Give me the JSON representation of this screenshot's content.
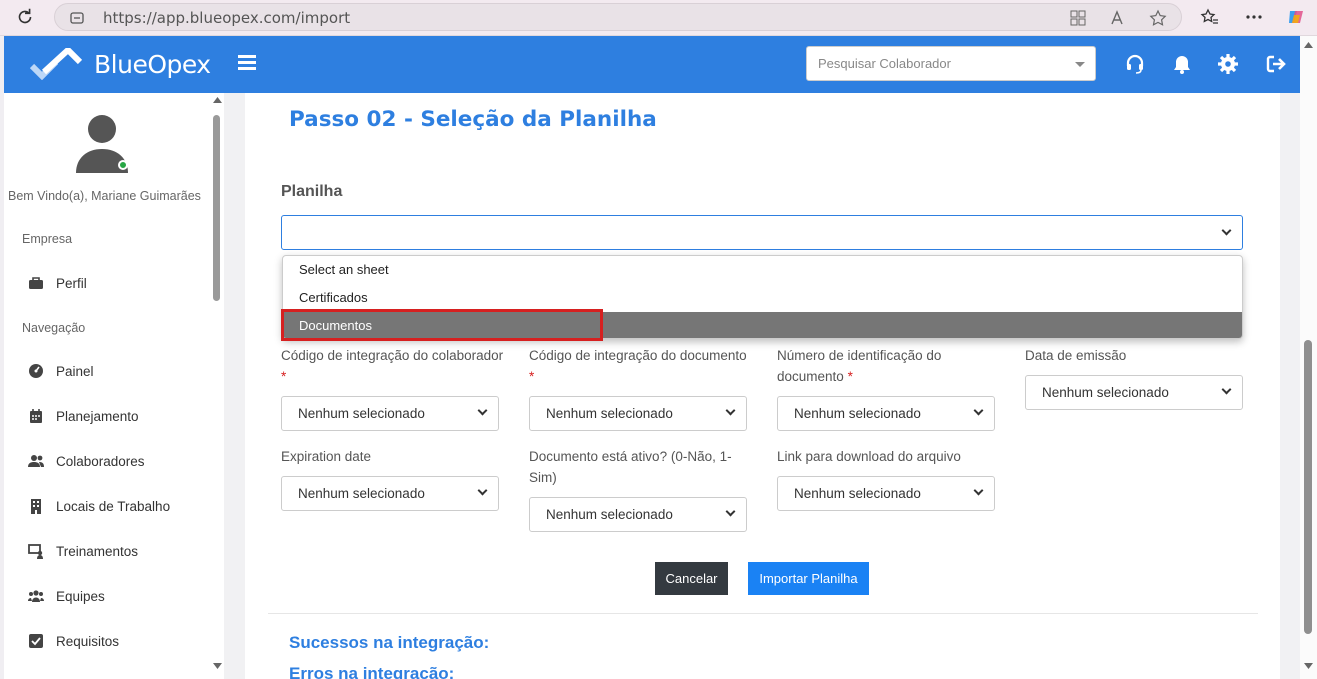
{
  "browser": {
    "url": "https://app.blueopex.com/import"
  },
  "header": {
    "brand": "BlueOpex",
    "search_placeholder": "Pesquisar Colaborador"
  },
  "sidebar": {
    "welcome": "Bem Vindo(a), Mariane Guimarães",
    "section_company": "Empresa",
    "section_nav": "Navegação",
    "items": [
      {
        "label": "Perfil",
        "icon": "briefcase-icon"
      },
      {
        "label": "Painel",
        "icon": "dashboard-icon"
      },
      {
        "label": "Planejamento",
        "icon": "calendar-icon"
      },
      {
        "label": "Colaboradores",
        "icon": "users-icon"
      },
      {
        "label": "Locais de Trabalho",
        "icon": "building-icon"
      },
      {
        "label": "Treinamentos",
        "icon": "training-icon"
      },
      {
        "label": "Equipes",
        "icon": "team-icon"
      },
      {
        "label": "Requisitos",
        "icon": "checkbox-icon"
      }
    ]
  },
  "main": {
    "step_title": "Passo 02 - Seleção da Planilha",
    "planilha_label": "Planilha",
    "planilha_value": "",
    "dropdown_options": [
      "Select an sheet",
      "Certificados",
      "Documentos"
    ],
    "dropdown_selected": "Documentos",
    "fields": [
      {
        "label": "Código de integração do colaborador",
        "required": true,
        "value": "Nenhum selecionado"
      },
      {
        "label": "Código de integração do documento",
        "required": true,
        "value": "Nenhum selecionado"
      },
      {
        "label": "Número de identificação do documento",
        "required": true,
        "value": "Nenhum selecionado"
      },
      {
        "label": "Data de emissão",
        "required": false,
        "value": "Nenhum selecionado"
      },
      {
        "label": "Expiration date",
        "required": false,
        "value": "Nenhum selecionado"
      },
      {
        "label": "Documento está ativo? (0-Não, 1-Sim)",
        "required": false,
        "value": "Nenhum selecionado"
      },
      {
        "label": "Link para download do arquivo",
        "required": false,
        "value": "Nenhum selecionado"
      }
    ],
    "required_mark": "*",
    "cancel_label": "Cancelar",
    "import_label": "Importar Planilha",
    "success_title": "Sucessos na integração:",
    "errors_title": "Erros na integração:"
  },
  "colors": {
    "brand_blue": "#2e7fe0",
    "button_blue": "#1a82f4",
    "button_dark": "#343a40",
    "highlight_red": "#d62020",
    "online_green": "#28a745"
  }
}
